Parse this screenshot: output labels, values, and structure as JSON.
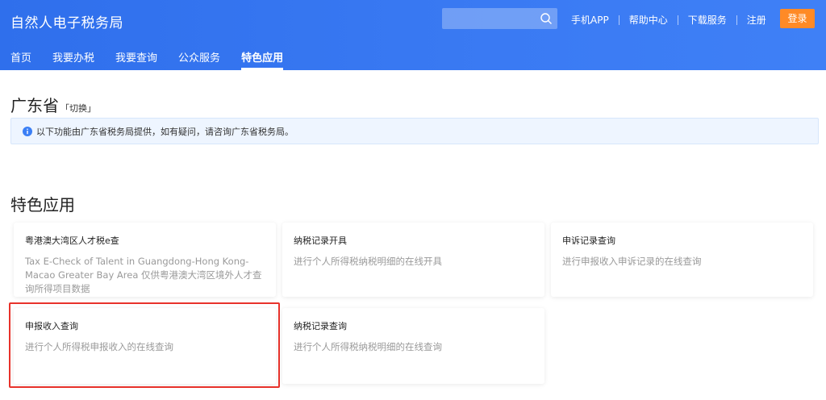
{
  "header": {
    "brand": "自然人电子税务局",
    "search_placeholder": "",
    "links": [
      "手机APP",
      "帮助中心",
      "下载服务",
      "注册"
    ],
    "login_label": "登录"
  },
  "nav": {
    "items": [
      "首页",
      "我要办税",
      "我要查询",
      "公众服务",
      "特色应用"
    ],
    "active_index": 4
  },
  "province": {
    "title": "广东省",
    "switch_label": "「切换」"
  },
  "notice": {
    "text": "以下功能由广东省税务局提供，如有疑问，请咨询广东省税务局。"
  },
  "section": {
    "title": "特色应用"
  },
  "cards": [
    {
      "title": "粤港澳大湾区人才税e查",
      "desc": "Tax E-Check of Talent in Guangdong-Hong Kong-Macao Greater Bay Area 仅供粤港澳大湾区境外人才查询所得项目数据"
    },
    {
      "title": "纳税记录开具",
      "desc": "进行个人所得税纳税明细的在线开具"
    },
    {
      "title": "申诉记录查询",
      "desc": "进行申报收入申诉记录的在线查询"
    },
    {
      "title": "申报收入查询",
      "desc": "进行个人所得税申报收入的在线查询"
    },
    {
      "title": "纳税记录查询",
      "desc": "进行个人所得税纳税明细的在线查询"
    }
  ],
  "colors": {
    "header_blue": "#3a7af3",
    "login_orange": "#ff8a26",
    "highlight_red": "#e8322b",
    "info_blue": "#3b7ff5"
  }
}
